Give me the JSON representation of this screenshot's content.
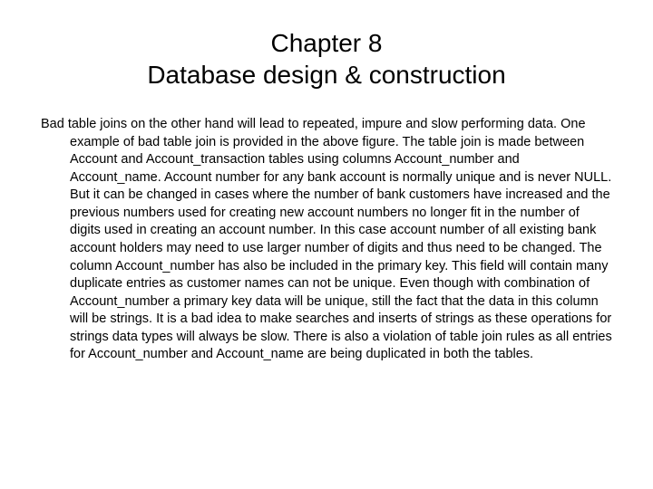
{
  "title": {
    "line1": "Chapter 8",
    "line2": "Database design & construction"
  },
  "body": "Bad table joins on the other hand will lead to repeated, impure and slow performing data. One example of bad table join is provided in the above figure. The table join is made between Account and Account_transaction tables using columns Account_number and Account_name. Account number for any bank account is normally unique and is never NULL. But it can be changed in cases where the number of bank customers have increased and the previous numbers used for creating new account numbers no longer fit in the number of digits used in creating an account number. In this case account number of all existing bank account holders may need to use larger number of digits and thus need to be changed. The column Account_number has also be included in the primary key. This field will contain many duplicate entries as customer names can not be unique. Even though with combination of Account_number a primary key data will be unique, still the fact that the data in this column will be strings. It is a bad idea to make searches and inserts of strings as these operations for strings data types will always be slow. There is also a violation of table join rules as all entries for Account_number and Account_name are being duplicated in both the tables."
}
